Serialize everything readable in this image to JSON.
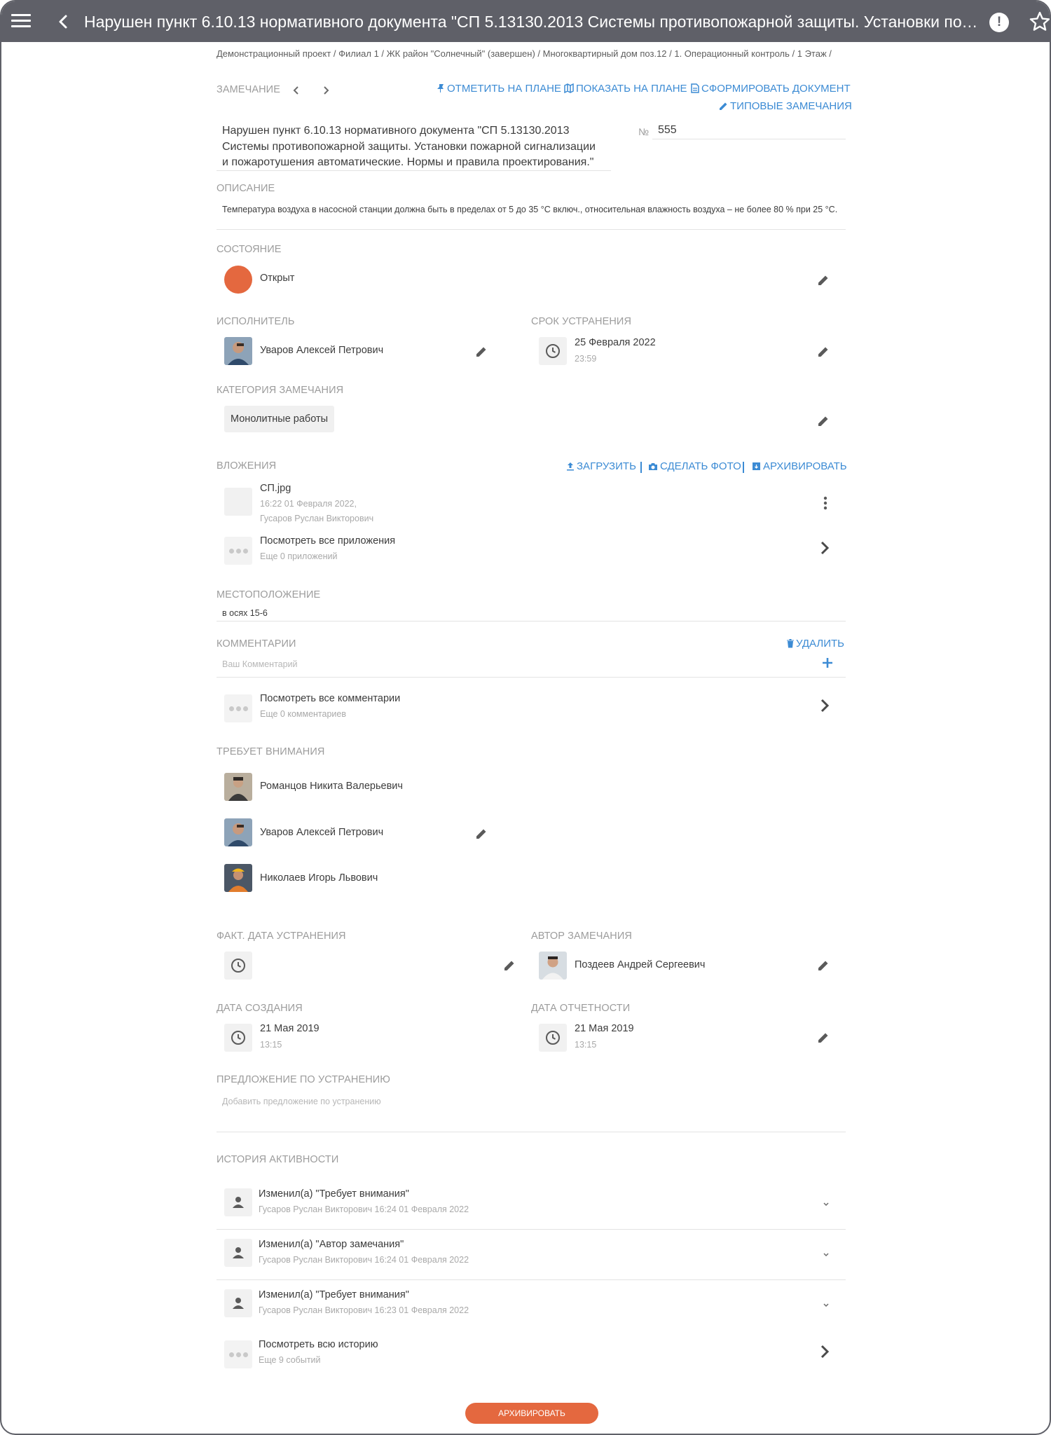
{
  "header": {
    "title": "Нарушен пункт 6.10.13 нормативного документа \"СП 5.13130.2013 Системы противопожарной защиты. Установки пожарной сигнализации и пожаротушения автоматические. Нормы и правила проектирования.\""
  },
  "breadcrumb": "Демонстрационный проект / Филиал 1 / ЖК район \"Солнечный\" (завершен) / Многоквартирный дом поз.12 / 1. Операционный контроль / 1 Этаж /",
  "remark": {
    "label": "Замечание",
    "actions": {
      "mark_on_plan": "Отметить на плане",
      "show_on_plan": "Показать на плане",
      "generate_document": "Сформировать документ",
      "typical_remarks": "Типовые замечания"
    },
    "text": "Нарушен пункт 6.10.13 нормативного документа \"СП 5.13130.2013 Системы противопожарной защиты. Установки пожарной сигнализации и пожаротушения автоматические. Нормы и правила проектирования.\"",
    "number_label": "№",
    "number": "555"
  },
  "description": {
    "label": "Описание",
    "text": "Температура воздуха в насосной станции должна быть в пределах от 5 до 35 °С включ., относительная влажность воздуха – не более 80 % при 25 °С."
  },
  "status": {
    "label": "Состояние",
    "value": "Открыт",
    "color": "#e4683f"
  },
  "executor": {
    "label": "Исполнитель",
    "name": "Уваров Алексей Петрович"
  },
  "deadline": {
    "label": "Срок устранения",
    "date": "25 Февраля 2022",
    "time": "23:59"
  },
  "category": {
    "label": "Категория замечания",
    "value": "Монолитные работы"
  },
  "attachments": {
    "label": "Вложения",
    "upload": "Загрузить",
    "take_photo": "Сделать фото",
    "archive": "Архивировать",
    "file_name": "СП.jpg",
    "file_date": "16:22 01 Февраля 2022,",
    "file_author": "Гусаров Руслан Викторович",
    "view_all": "Посмотреть все приложения",
    "view_all_sub": "Еще 0 приложений"
  },
  "location": {
    "label": "Местоположение",
    "value": "в осях 15-6"
  },
  "comments": {
    "label": "Комментарии",
    "delete": "Удалить",
    "placeholder": "Ваш Комментарий",
    "view_all": "Посмотреть все комментарии",
    "view_all_sub": "Еще 0 комментариев"
  },
  "attention": {
    "label": "Требует внимания",
    "people": [
      "Романцов Никита Валерьевич",
      "Уваров Алексей Петрович",
      "Николаев Игорь Львович"
    ]
  },
  "fact_date": {
    "label": "Факт. дата устранения"
  },
  "author": {
    "label": "Автор замечания",
    "name": "Поздеев Андрей Сергеевич"
  },
  "created": {
    "label": "Дата создания",
    "date": "21 Мая 2019",
    "time": "13:15"
  },
  "report_date": {
    "label": "Дата отчетности",
    "date": "21 Мая 2019",
    "time": "13:15"
  },
  "proposal": {
    "label": "Предложение по устранению",
    "placeholder": "Добавить предложение по устранению"
  },
  "history": {
    "label": "История активности",
    "items": [
      {
        "title": "Изменил(а) \"Требует внимания\"",
        "meta": "Гусаров Руслан Викторович 16:24 01 Февраля 2022"
      },
      {
        "title": "Изменил(а) \"Автор замечания\"",
        "meta": "Гусаров Руслан Викторович 16:24 01 Февраля 2022"
      },
      {
        "title": "Изменил(а) \"Требует внимания\"",
        "meta": "Гусаров Руслан Викторович 16:23 01 Февраля 2022"
      }
    ],
    "view_all": "Посмотреть всю историю",
    "view_all_sub": "Еще 9 событий"
  },
  "footer": {
    "archive_button": "Архивировать"
  },
  "colors": {
    "topbar": "#5f6068",
    "accent": "#3c8bd4",
    "status_open": "#e4683f"
  }
}
